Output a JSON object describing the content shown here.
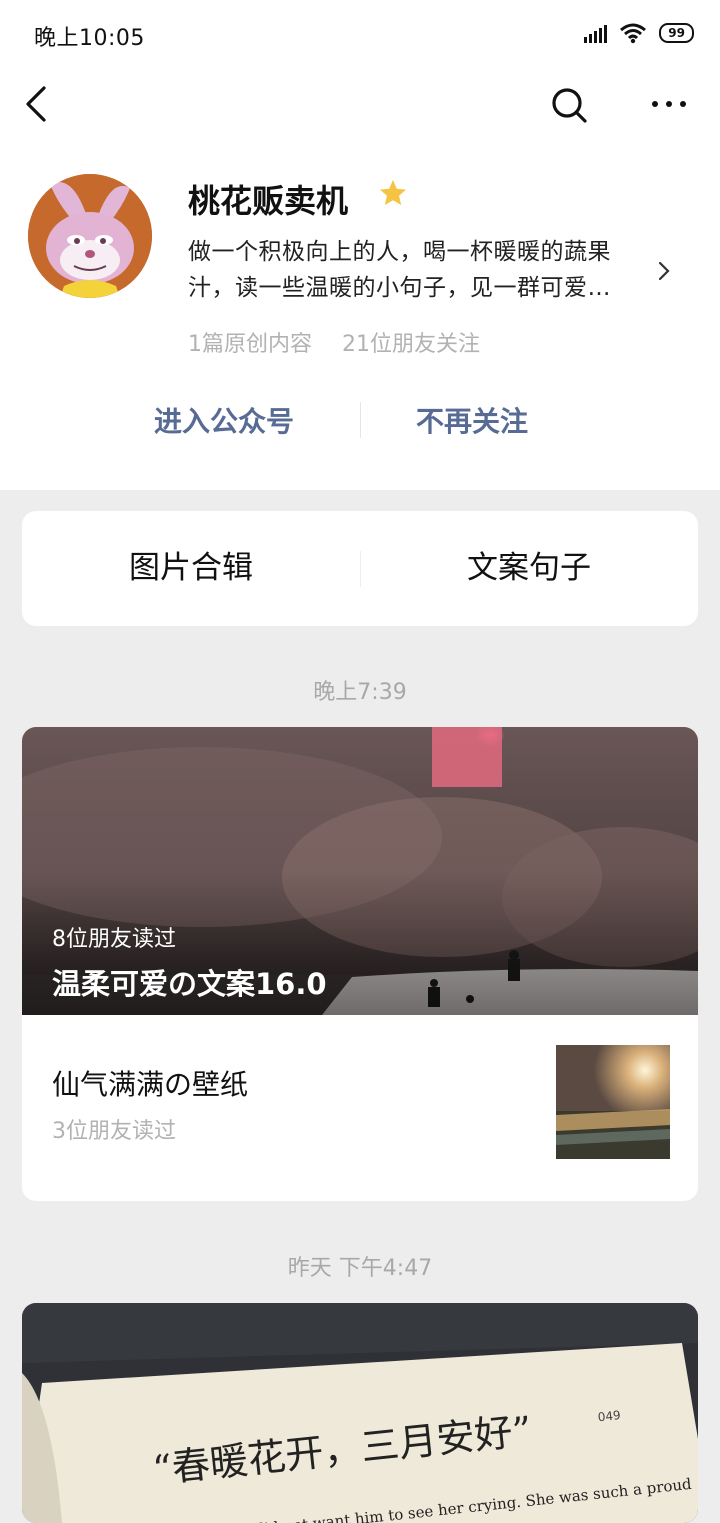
{
  "status_bar": {
    "time": "晚上10:05",
    "battery": "99"
  },
  "account": {
    "name": "桃花贩卖机",
    "description": "做一个积极向上的人，喝一杯暖暖的蔬果汁，读一些温暖的小句子，见一群可爱…",
    "original_count": "1篇原创内容",
    "friends_following": "21位朋友关注"
  },
  "actions": {
    "enter": "进入公众号",
    "unfollow": "不再关注"
  },
  "menu": [
    "图片合辑",
    "文案句子"
  ],
  "feed": [
    {
      "time": "晚上7:39",
      "cover_readers": "8位朋友读过",
      "cover_title": "温柔可爱の文案16.0",
      "sub_title": "仙气满满の壁纸",
      "sub_readers": "3位朋友读过"
    },
    {
      "time": "昨天 下午4:47",
      "cover_handwriting": "“春暖花开，三月安好”",
      "cover_page_number": "049",
      "cover_book_line": "lid not want him to see her crying. She was such a proud"
    }
  ],
  "colors": {
    "link": "#576b95",
    "star": "#f6c343",
    "background": "#ededed"
  }
}
